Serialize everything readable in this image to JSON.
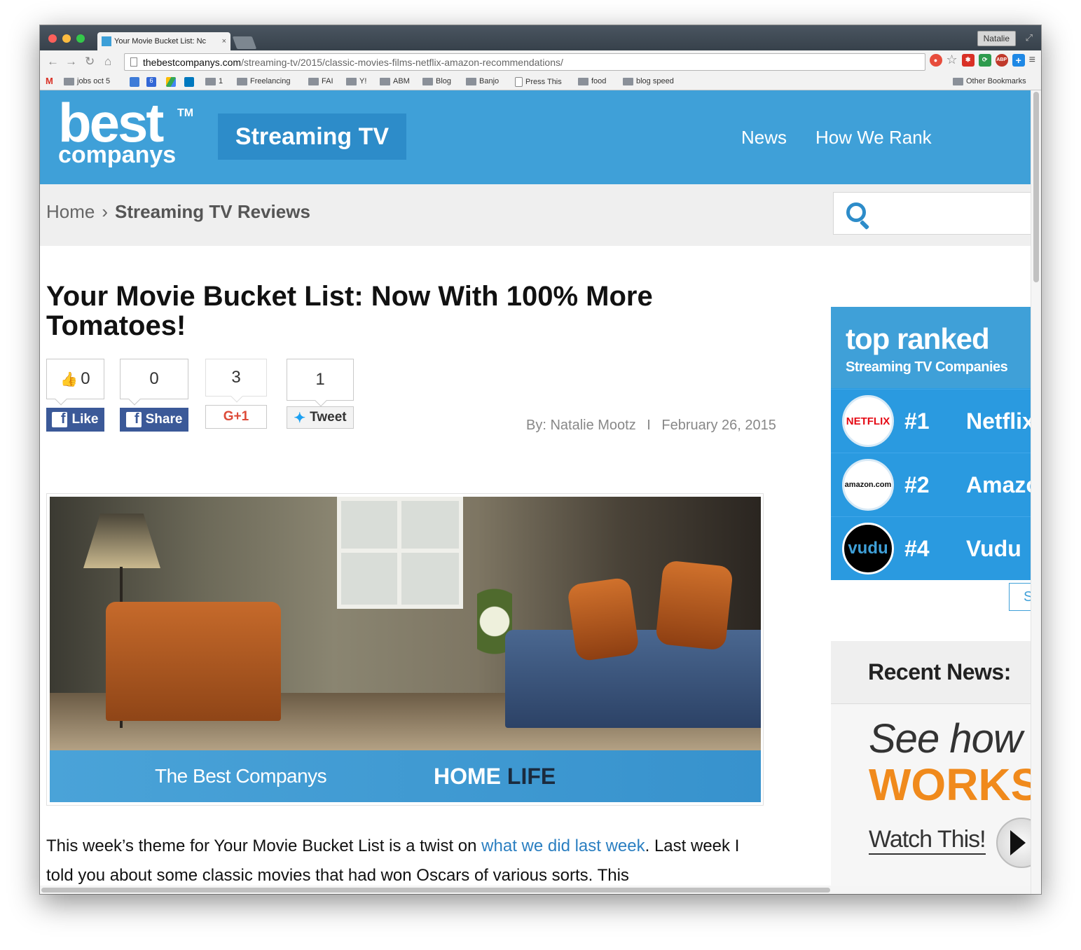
{
  "browser": {
    "tab_title": "Your Movie Bucket List: Nc",
    "tab_close": "×",
    "profile": "Natalie",
    "url_host": "thebestcompanys.com",
    "url_path": "/streaming-tv/2015/classic-movies-films-netflix-amazon-recommendations/",
    "bookmarks": [
      "jobs oct 5",
      "1",
      "Freelancing",
      "FAI",
      "Y!",
      "ABM",
      "Blog",
      "Banjo",
      "Press This",
      "food",
      "blog speed"
    ],
    "other_bookmarks": "Other Bookmarks",
    "gmail_glyph": "M",
    "calendar_glyph": "6",
    "ext_abp": "ABP"
  },
  "header": {
    "logo_best": "best",
    "logo_companys": "companys",
    "logo_tm": "TM",
    "category": "Streaming TV",
    "nav": [
      "News",
      "How We Rank"
    ]
  },
  "breadcrumb": {
    "home": "Home",
    "separator": "›",
    "current": "Streaming TV Reviews"
  },
  "article": {
    "title": "Your Movie Bucket List: Now With 100% More Tomatoes!",
    "shares": {
      "like_count": "0",
      "share_count": "0",
      "gplus_count": "3",
      "tweet_count": "1",
      "like_label": "Like",
      "share_label": "Share",
      "gplus_label": "G+1",
      "tweet_label": "Tweet"
    },
    "byline": "By: Natalie Mootz",
    "byline_sep": "I",
    "date": "February 26, 2015",
    "hero_band_left": "The Best Companys",
    "hero_band_home": "HOME",
    "hero_band_life": "LIFE",
    "body_pre": "This week’s theme for Your Movie Bucket List is a twist on ",
    "body_link": "what we did last week",
    "body_post": ". Last week I told you about some classic movies that had won Oscars of various sorts. This"
  },
  "sidebar": {
    "top_ranked_big": "top ranked",
    "top_ranked_small": "Streaming TV Companies",
    "ranks": [
      {
        "rank": "#1",
        "name": "Netflix",
        "logo": "NETFLIX",
        "logo_color": "#e50914"
      },
      {
        "rank": "#2",
        "name": "Amazon",
        "logo": "amazon.com",
        "logo_color": "#111111"
      },
      {
        "rank": "#4",
        "name": "Vudu",
        "logo": "vudu",
        "logo_color": "#3fa0d8"
      }
    ],
    "see_all": "S",
    "recent_news": "Recent News:",
    "ad_see": "See how it",
    "ad_works": "WORKS",
    "ad_watch": "Watch This!"
  },
  "colors": {
    "brand_blue": "#3fa0d8",
    "badge_blue": "#2d8cc9",
    "facebook": "#3b5998",
    "gplus": "#dd4b39",
    "ad_orange": "#f08a1c"
  }
}
